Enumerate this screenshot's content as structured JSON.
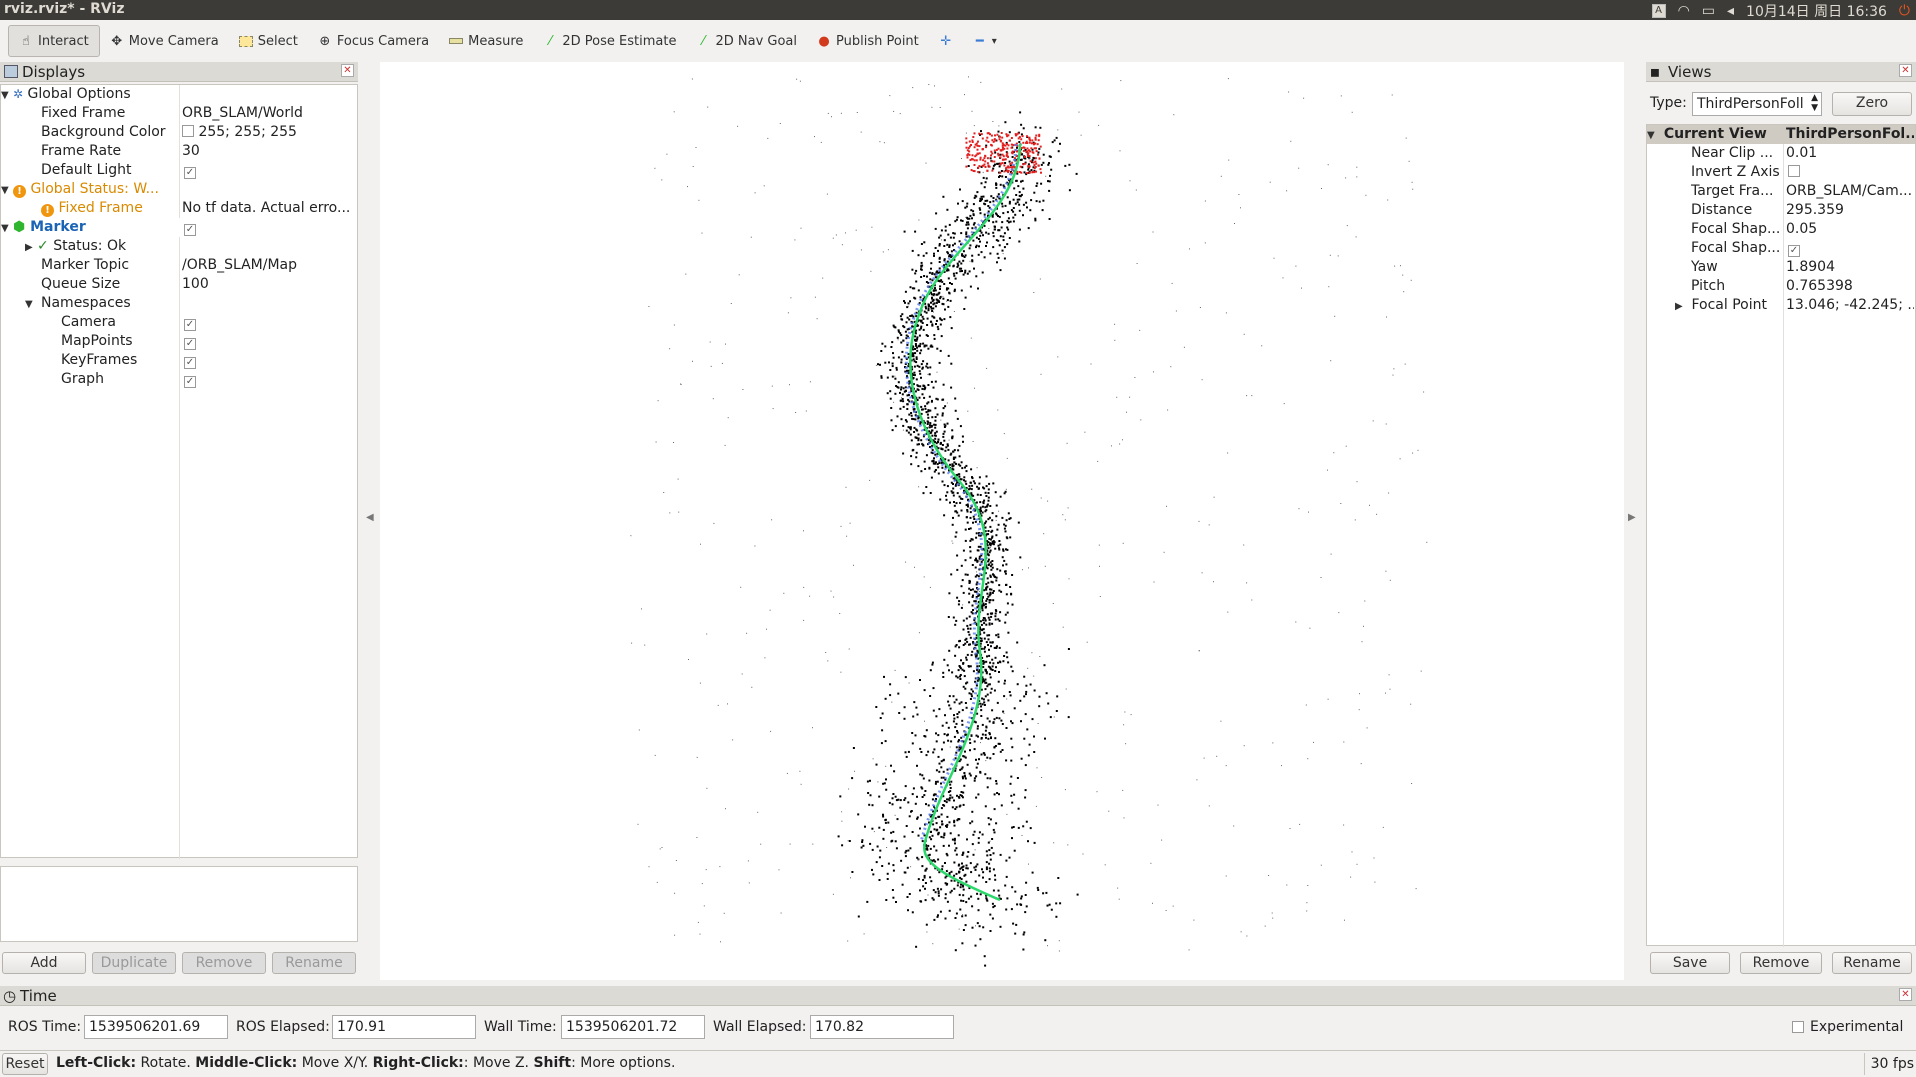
{
  "window": {
    "title": "rviz.rviz* - RViz"
  },
  "tray": {
    "indicator": "A",
    "datetime": "10月14日 周日 16:36"
  },
  "toolbar": {
    "tools": [
      {
        "label": "Interact",
        "icon": "hand-icon"
      },
      {
        "label": "Move Camera",
        "icon": "move-camera-icon"
      },
      {
        "label": "Select",
        "icon": "select-icon"
      },
      {
        "label": "Focus Camera",
        "icon": "focus-camera-icon"
      },
      {
        "label": "Measure",
        "icon": "ruler-icon"
      },
      {
        "label": "2D Pose Estimate",
        "icon": "green-arrow-icon"
      },
      {
        "label": "2D Nav Goal",
        "icon": "green-arrow-icon"
      },
      {
        "label": "Publish Point",
        "icon": "pin-icon"
      }
    ]
  },
  "displays": {
    "title": "Displays",
    "global_options": "Global Options",
    "fixed_frame_label": "Fixed Frame",
    "fixed_frame_value": "ORB_SLAM/World",
    "bg_color_label": "Background Color",
    "bg_color_value": "255; 255; 255",
    "frame_rate_label": "Frame Rate",
    "frame_rate_value": "30",
    "default_light_label": "Default Light",
    "global_status": "Global Status: W...",
    "gs_fixed_frame": "Fixed Frame",
    "gs_fixed_frame_value": "No tf data.  Actual erro...",
    "marker": "Marker",
    "status": "Status: Ok",
    "marker_topic_label": "Marker Topic",
    "marker_topic_value": "/ORB_SLAM/Map",
    "queue_size_label": "Queue Size",
    "queue_size_value": "100",
    "namespaces": "Namespaces",
    "ns": [
      "Camera",
      "MapPoints",
      "KeyFrames",
      "Graph"
    ],
    "buttons": {
      "add": "Add",
      "duplicate": "Duplicate",
      "remove": "Remove",
      "rename": "Rename"
    }
  },
  "views": {
    "title": "Views",
    "type_label": "Type:",
    "type_value": "ThirdPersonFoll",
    "zero": "Zero",
    "current_view": "Current View",
    "current_view_value": "ThirdPersonFol...",
    "props": [
      {
        "k": "Near Clip ...",
        "v": "0.01"
      },
      {
        "k": "Invert Z Axis",
        "v": ""
      },
      {
        "k": "Target Fra...",
        "v": "ORB_SLAM/Cam..."
      },
      {
        "k": "Distance",
        "v": "295.359"
      },
      {
        "k": "Focal Shap...",
        "v": "0.05"
      },
      {
        "k": "Focal Shap...",
        "v": ""
      },
      {
        "k": "Yaw",
        "v": "1.8904"
      },
      {
        "k": "Pitch",
        "v": "0.765398"
      },
      {
        "k": "Focal Point",
        "v": "13.046; -42.245; ..."
      }
    ],
    "buttons": {
      "save": "Save",
      "remove": "Remove",
      "rename": "Rename"
    }
  },
  "time": {
    "title": "Time",
    "ros_time_label": "ROS Time:",
    "ros_time": "1539506201.69",
    "ros_elapsed_label": "ROS Elapsed:",
    "ros_elapsed": "170.91",
    "wall_time_label": "Wall Time:",
    "wall_time": "1539506201.72",
    "wall_elapsed_label": "Wall Elapsed:",
    "wall_elapsed": "170.82",
    "experimental": "Experimental"
  },
  "status": {
    "reset": "Reset",
    "b1": "Left-Click:",
    "t1": " Rotate. ",
    "b2": "Middle-Click:",
    "t2": " Move X/Y. ",
    "b3": "Right-Click:",
    "t3": ": Move Z. ",
    "b4": "Shift",
    "t4": ": More options.",
    "fps": "30 fps"
  }
}
